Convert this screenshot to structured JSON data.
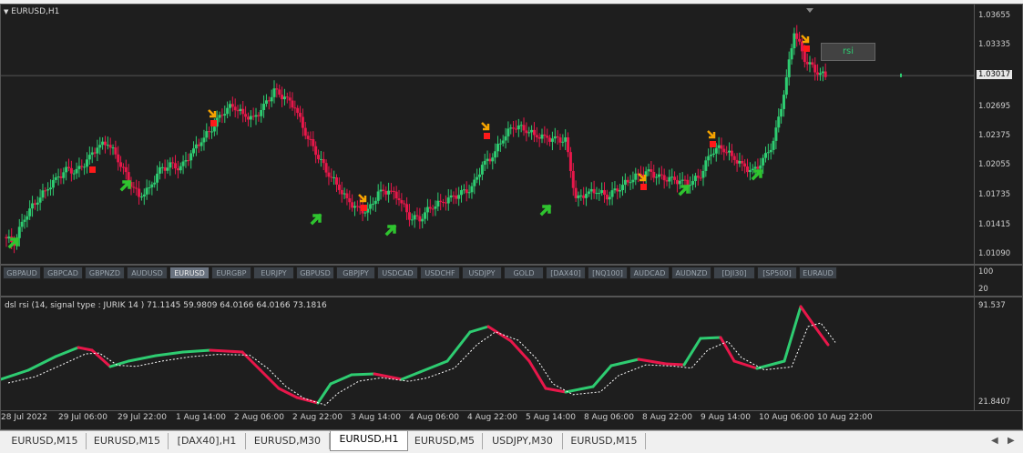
{
  "main_chart": {
    "title": "EURUSD,H1",
    "price_labels": [
      "1.03655",
      "1.03335",
      "1.03017",
      "1.02695",
      "1.02375",
      "1.02055",
      "1.01735",
      "1.01415",
      "1.01090"
    ],
    "current_price": "1.03017",
    "rsi_button_label": "rsi",
    "pair_buttons": [
      "GBPAUD",
      "GBPCAD",
      "GBPNZD",
      "AUDUSD",
      "EURUSD",
      "EURGBP",
      "EURJPY",
      "GBPUSD",
      "GBPJPY",
      "USDCAD",
      "USDCHF",
      "USDJPY",
      "GOLD",
      "[DAX40]",
      "[NQ100]",
      "AUDCAD",
      "AUDNZD",
      "[DJI30]",
      "[SP500]",
      "EURAUD"
    ],
    "active_pair": "EURUSD"
  },
  "button_panel_scale": {
    "max": "100",
    "min": "20"
  },
  "indicator": {
    "label": "dsl rsi (14, signal type : JURIK  14 ) 71.1145 59.9809 64.0166 64.0166 73.1816",
    "max_label": "91.537",
    "min_label": "21.8407"
  },
  "time_labels": [
    "28 Jul 2022",
    "29 Jul 06:00",
    "29 Jul 22:00",
    "1 Aug 14:00",
    "2 Aug 06:00",
    "2 Aug 22:00",
    "3 Aug 14:00",
    "4 Aug 06:00",
    "4 Aug 22:00",
    "5 Aug 14:00",
    "8 Aug 06:00",
    "8 Aug 22:00",
    "9 Aug 14:00",
    "10 Aug 06:00",
    "10 Aug 22:00"
  ],
  "tabs": [
    "EURUSD,M15",
    "EURUSD,M15",
    "[DAX40],H1",
    "EURUSD,M30",
    "EURUSD,H1",
    "EURUSD,M5",
    "USDJPY,M30",
    "EURUSD,M15"
  ],
  "active_tab": "EURUSD,H1",
  "colors": {
    "bull": "#2ecc71",
    "bear": "#e8174a",
    "arrow_up": "#2fc42f",
    "arrow_down_orange": "#f5a300",
    "arrow_down_red": "#ff1a1a",
    "background": "#1e1e1e"
  },
  "chart_data": {
    "type": "candlestick",
    "series": [
      {
        "name": "EURUSD,H1",
        "close": [
          1.0122,
          1.015,
          1.0165,
          1.0178,
          1.019,
          1.02,
          1.0198,
          1.021,
          1.0225,
          1.023,
          1.0212,
          1.019,
          1.0172,
          1.018,
          1.02,
          1.0205,
          1.0202,
          1.0218,
          1.0232,
          1.0245,
          1.0262,
          1.027,
          1.026,
          1.0255,
          1.0268,
          1.0285,
          1.0278,
          1.0268,
          1.024,
          1.022,
          1.02,
          1.0185,
          1.0168,
          1.0158,
          1.0155,
          1.0175,
          1.0178,
          1.017,
          1.015,
          1.0148,
          1.016,
          1.0165,
          1.017,
          1.0175,
          1.018,
          1.0205,
          1.0215,
          1.0235,
          1.0248,
          1.0245,
          1.0238,
          1.0235,
          1.0233,
          1.0232,
          1.0168,
          1.0175,
          1.0178,
          1.0172,
          1.018,
          1.0188,
          1.0195,
          1.0198,
          1.0192,
          1.019,
          1.0188,
          1.0186,
          1.0195,
          1.022,
          1.0225,
          1.0215,
          1.0205,
          1.0198,
          1.021,
          1.023,
          1.0282,
          1.035,
          1.032,
          1.0308,
          1.0301
        ]
      }
    ]
  }
}
